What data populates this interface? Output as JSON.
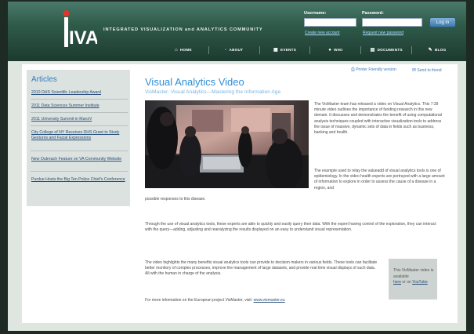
{
  "header": {
    "logo_text": "IVAC",
    "site_title": "INTEGRATED VISUALIZATION and ANALYTICS COMMUNITY",
    "login": {
      "username_label": "Username:",
      "password_label": "Password:",
      "create_account": "Create new account",
      "request_password": "Request new password",
      "login_button": "Log in"
    },
    "nav": [
      {
        "label": "HOME",
        "icon": "home-icon"
      },
      {
        "label": "ABOUT",
        "icon": "info-icon"
      },
      {
        "label": "EVENTS",
        "icon": "calendar-icon"
      },
      {
        "label": "WIKI",
        "icon": "wiki-icon"
      },
      {
        "label": "DOCUMENTS",
        "icon": "document-icon"
      },
      {
        "label": "BLOG",
        "icon": "pen-icon"
      }
    ]
  },
  "sidebar": {
    "title": "Articles",
    "items": [
      "2010 DHS Scientific Leadership Award",
      "2011 Data Sciences Summer Institute",
      "2011 University Summit in March!",
      "City College of NY Receives DHS Grant to Study Gestures and Facial Expressions",
      "New Outreach Feature on VA Community Website",
      "Purdue Hosts the Big Ten Police Chief's Conference"
    ]
  },
  "tools": {
    "print": "Printer Friendly version",
    "send": "Send to friend"
  },
  "article": {
    "title": "Visual Analytics Video",
    "subtitle": "VisMaster: Visual Analytics—Mastering the Information Age",
    "p1": "The VisMaster team has released a video on Visual Analytics. This 7:39 minute video outlines the importance of funding research in this new domain. It discusses and demonstrates the benefit of using computational analysis techniques coupled with interactive visualization tools to address the issue of massive, dynamic sets of data in fields such as business, banking and health.",
    "p2": "The example used to relay the valueadd of visual analytics tools is one of epidemiology. In the video health experts are portrayed with a large amount of information to explore in order to assess the cause of a disease in a region, and",
    "p2b": "possible responses to this disease.",
    "p3": "Through the use of visual analytics tools, these experts are able to quickly and easily query their data. With the expert having control of the exploration, they can interact with the query—adding, adjusting and reanalyzing the results displayed on an easy   to   understand visual representation.",
    "p4": "The video highlights the many benefits visual analytics tools can provide to decision makers in various fields. These tools can facilitate better monitory of complex processes, improve the management of large datasets, and provide real   time visual displays of such data. All with the human in charge of the analysis.",
    "footer_text": "For more information on the European project VisMaster, visit: ",
    "footer_link": "www.vismaster.eu"
  },
  "video_box": {
    "text": "This VisMaster video is available",
    "here": "here",
    "or_on": " or on ",
    "youtube": "YouTube"
  },
  "colors": {
    "accent": "#2f8fd8",
    "header_dark": "#1c3a30",
    "link": "#2a4f7a"
  }
}
